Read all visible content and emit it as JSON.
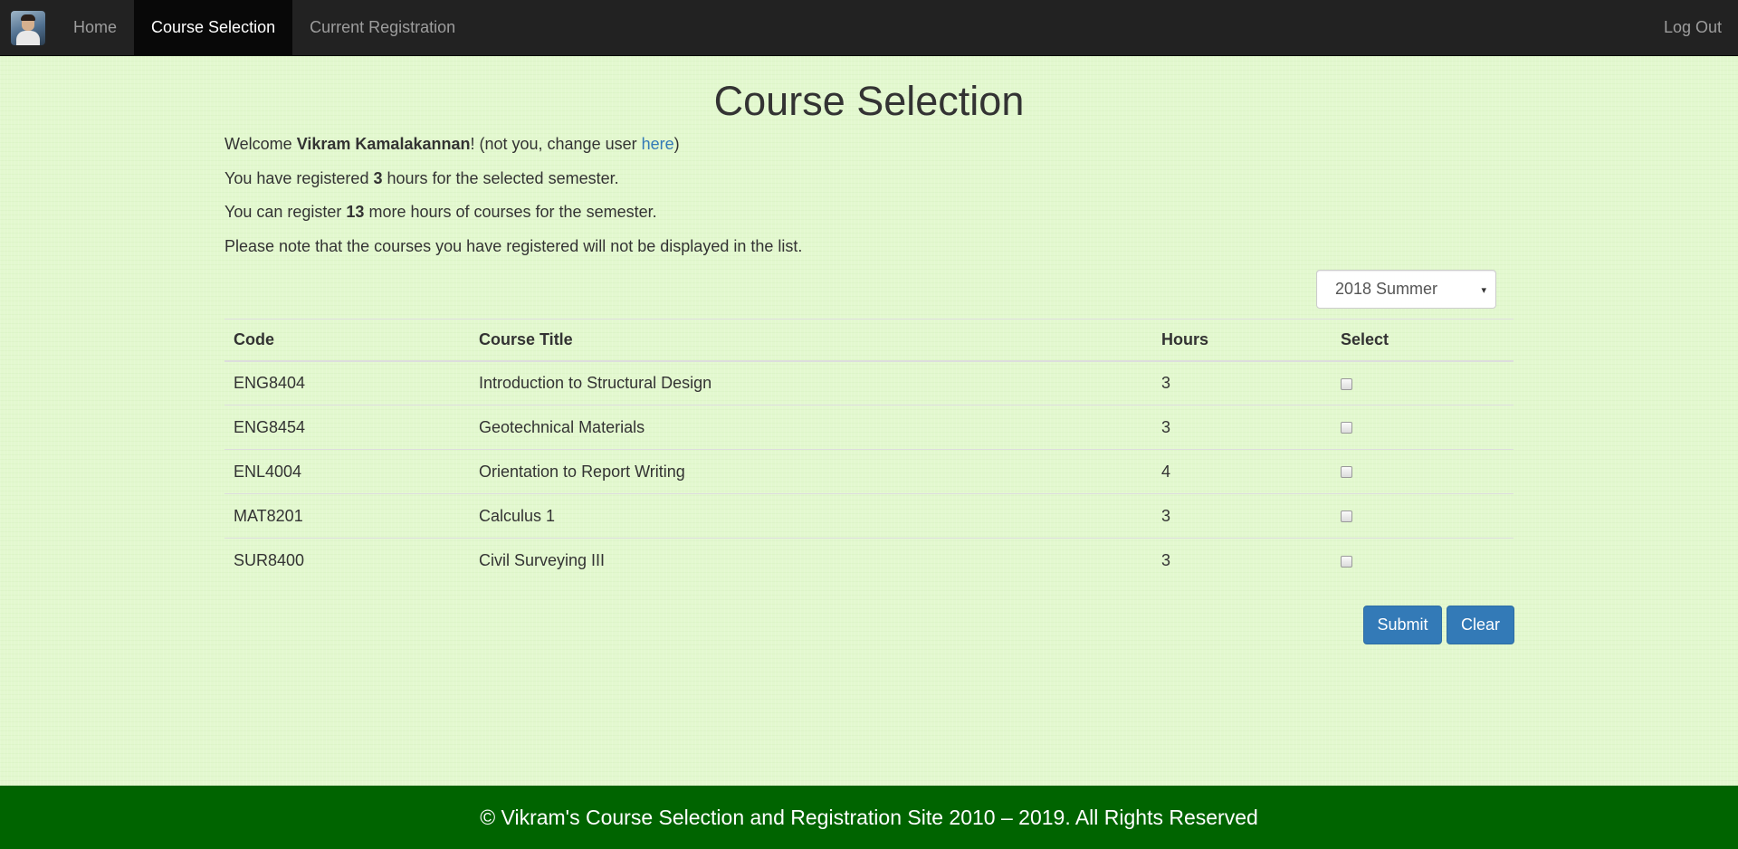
{
  "nav": {
    "items": [
      {
        "label": "Home"
      },
      {
        "label": "Course Selection"
      },
      {
        "label": "Current Registration"
      }
    ],
    "logout_label": "Log Out"
  },
  "page": {
    "title": "Course Selection",
    "welcome_prefix": "Welcome ",
    "user_name": "Vikram Kamalakannan",
    "welcome_suffix": "! (not you, change user ",
    "change_user_link": "here",
    "welcome_close": ")",
    "registered_prefix": "You have registered ",
    "registered_hours": "3",
    "registered_suffix": " hours for the selected semester.",
    "remaining_prefix": "You can register ",
    "remaining_hours": "13",
    "remaining_suffix": " more hours of courses for the semester.",
    "note": "Please note that the courses you have registered will not be displayed in the list."
  },
  "semester": {
    "selected": "2018 Summer",
    "caret": "▾"
  },
  "table": {
    "headers": {
      "code": "Code",
      "title": "Course Title",
      "hours": "Hours",
      "select": "Select"
    },
    "rows": [
      {
        "code": "ENG8404",
        "title": "Introduction to Structural Design",
        "hours": "3",
        "selected": false
      },
      {
        "code": "ENG8454",
        "title": "Geotechnical Materials",
        "hours": "3",
        "selected": false
      },
      {
        "code": "ENL4004",
        "title": "Orientation to Report Writing",
        "hours": "4",
        "selected": false
      },
      {
        "code": "MAT8201",
        "title": "Calculus 1",
        "hours": "3",
        "selected": false
      },
      {
        "code": "SUR8400",
        "title": "Civil Surveying III",
        "hours": "3",
        "selected": false
      }
    ]
  },
  "buttons": {
    "submit": "Submit",
    "clear": "Clear"
  },
  "footer": {
    "text": "© Vikram's Course Selection and Registration Site 2010 – 2019. All Rights Reserved"
  },
  "colors": {
    "navbar": "#222222",
    "footer": "#006400",
    "button": "#337ab7",
    "link": "#337ab7",
    "background": "#e3f8cf"
  }
}
